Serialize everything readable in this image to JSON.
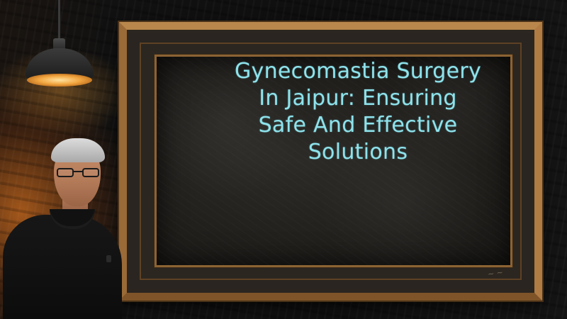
{
  "headline": {
    "line1": "Gynecomastia Surgery",
    "line2": "In Jaipur: Ensuring",
    "line3": "Safe And Effective",
    "line4": "Solutions"
  },
  "colors": {
    "headline_text": "#8ee3ec",
    "frame_wood": "#a3743e",
    "chalkboard": "#242220",
    "lamp_glow": "#f2a640"
  },
  "icons": {
    "lamp": "pendant-lamp-icon"
  }
}
